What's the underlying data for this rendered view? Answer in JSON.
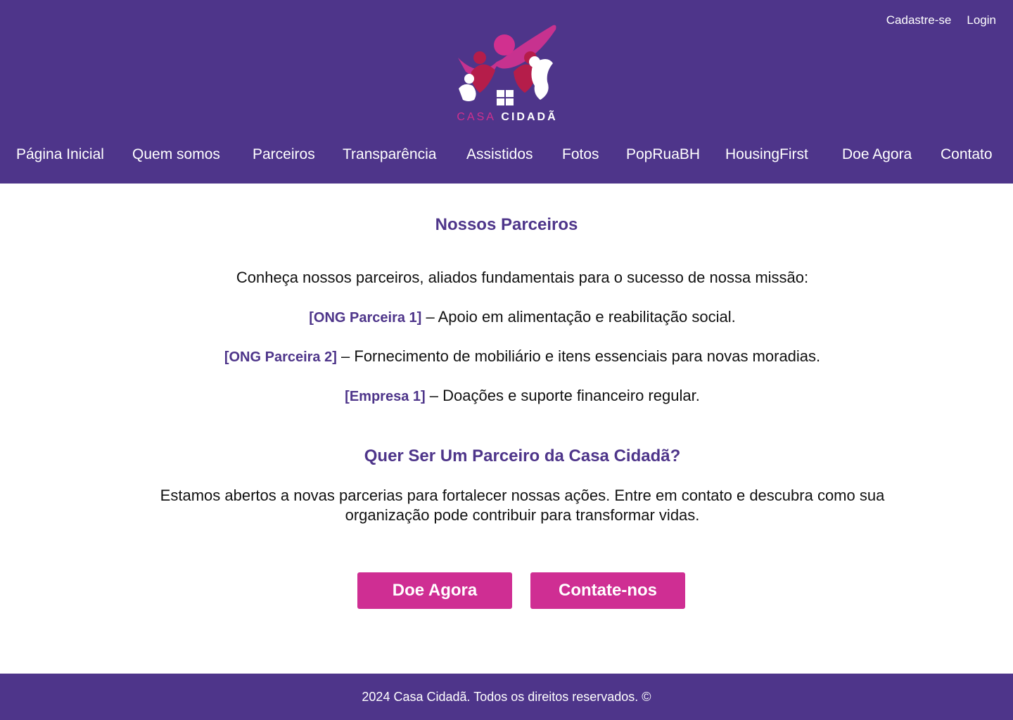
{
  "header": {
    "auth": {
      "signup": "Cadastre-se",
      "login": "Login"
    },
    "logo": {
      "word1": "CASA",
      "word2": "CIDADÃ"
    },
    "nav": [
      "Página Inicial",
      "Quem somos",
      "Parceiros",
      "Transparência",
      "Assistidos",
      "Fotos",
      "PopRuaBH",
      "HousingFirst",
      "Doe Agora",
      "Contato"
    ]
  },
  "main": {
    "title": "Nossos Parceiros",
    "intro": "Conheça nossos parceiros, aliados fundamentais para o sucesso de nossa missão:",
    "partners": [
      {
        "name": "[ONG Parceira 1]",
        "desc": "– Apoio em alimentação e reabilitação social."
      },
      {
        "name": "[ONG Parceira 2]",
        "desc": "– Fornecimento de mobiliário e itens essenciais para novas moradias."
      },
      {
        "name": "[Empresa 1]",
        "desc": "– Doações e suporte financeiro regular."
      }
    ],
    "cta_title": "Quer Ser Um Parceiro da Casa Cidadã?",
    "cta_text": "Estamos abertos a novas parcerias para fortalecer nossas ações. Entre em contato e descubra como sua organização pode contribuir para transformar vidas.",
    "buttons": {
      "donate": "Doe Agora",
      "contact": "Contate-nos"
    }
  },
  "footer": {
    "copyright": "2024 Casa Cidadã. Todos os direitos reservados. ©"
  },
  "colors": {
    "primary": "#4e358a",
    "accent": "#cf2e93",
    "text": "#111111"
  }
}
